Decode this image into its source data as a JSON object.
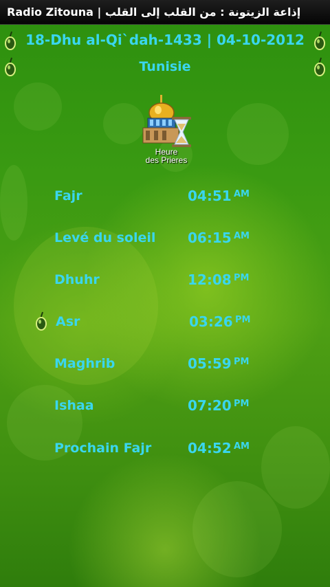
{
  "window": {
    "title": "Radio Zitouna | إذاعة الزيتونة : من القلب إلى القلب"
  },
  "header": {
    "date": "18-Dhu al-Qi`dah-1433 | 04-10-2012",
    "country": "Tunisie"
  },
  "logo": {
    "line1": "Heure",
    "line2": "des Prieres"
  },
  "prayers": [
    {
      "name": "Fajr",
      "time": "04:51",
      "ampm": "AM",
      "current": false
    },
    {
      "name": "Levé du soleil",
      "time": "06:15",
      "ampm": "AM",
      "current": false
    },
    {
      "name": "Dhuhr",
      "time": "12:08",
      "ampm": "PM",
      "current": false
    },
    {
      "name": "Asr",
      "time": "03:26",
      "ampm": "PM",
      "current": true
    },
    {
      "name": "Maghrib",
      "time": "05:59",
      "ampm": "PM",
      "current": false
    },
    {
      "name": "Ishaa",
      "time": "07:20",
      "ampm": "PM",
      "current": false
    },
    {
      "name": "Prochain Fajr",
      "time": "04:52",
      "ampm": "AM",
      "current": false
    }
  ],
  "icons": {
    "corner": "olive-icon",
    "current_prayer_marker": "olive-icon",
    "logo": "mosque-hourglass-icon"
  },
  "colors": {
    "text_accent": "#3ad6ee",
    "background": "#3a9a12",
    "titlebar": "#0a0a0a"
  }
}
